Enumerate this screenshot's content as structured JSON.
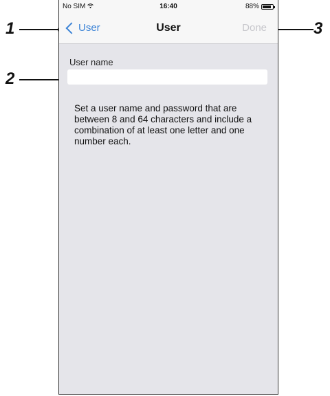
{
  "status_bar": {
    "carrier": "No SIM",
    "wifi_icon": "wifi-icon",
    "time": "16:40",
    "battery": "88%",
    "battery_level": 0.88
  },
  "nav": {
    "back_label": "User",
    "title": "User",
    "done_label": "Done"
  },
  "form": {
    "field_label": "User name",
    "field_value": "",
    "help_text": "Set a user name and password that are between 8 and 64 characters and include a combination of at least one letter and one number each."
  },
  "callouts": [
    "1",
    "2",
    "3"
  ],
  "colors": {
    "accent": "#3b83d6",
    "disabled": "#c7c7cc",
    "background": "#e5e5ea"
  }
}
